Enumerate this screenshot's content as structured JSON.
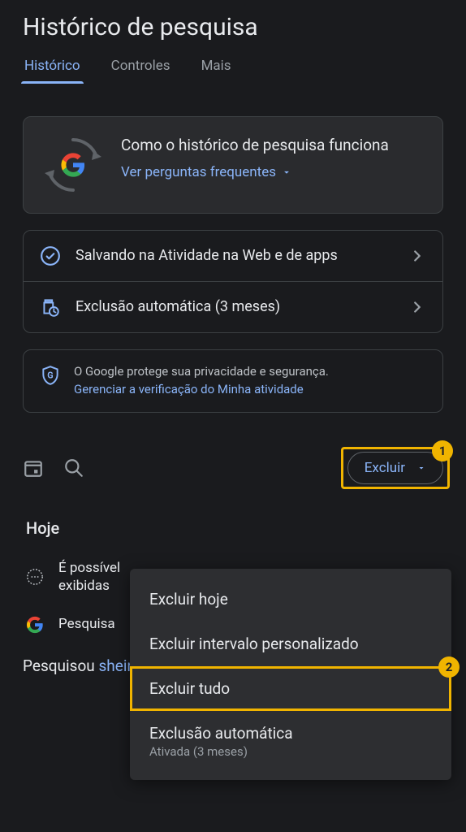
{
  "header": {
    "title": "Histórico de pesquisa",
    "tabs": [
      {
        "label": "Histórico",
        "active": true
      },
      {
        "label": "Controles",
        "active": false
      },
      {
        "label": "Mais",
        "active": false
      }
    ]
  },
  "faq_card": {
    "title": "Como o histórico de pesquisa funciona",
    "link": "Ver perguntas frequentes"
  },
  "settings": [
    {
      "icon": "check-circle",
      "label": "Salvando na Atividade na Web e de apps"
    },
    {
      "icon": "auto-delete",
      "label": "Exclusão automática (3 meses)"
    }
  ],
  "privacy_card": {
    "text": "O Google protege sua privacidade e segurança.",
    "link": "Gerenciar a verificação do Minha atividade"
  },
  "toolbar": {
    "delete_label": "Excluir"
  },
  "annotations": {
    "badge1": "1",
    "badge2": "2"
  },
  "dropdown": {
    "items": [
      {
        "label": "Excluir hoje"
      },
      {
        "label": "Excluir intervalo personalizado"
      },
      {
        "label": "Excluir tudo",
        "highlighted": true
      },
      {
        "label": "Exclusão automática",
        "sub": "Ativada (3 meses)"
      }
    ]
  },
  "history": {
    "section": "Hoje",
    "row1": "É possível",
    "row1b": "exibidas",
    "row2": "Pesquisa",
    "bottom_prefix": "Pesquisou ",
    "bottom_term": "shein"
  }
}
